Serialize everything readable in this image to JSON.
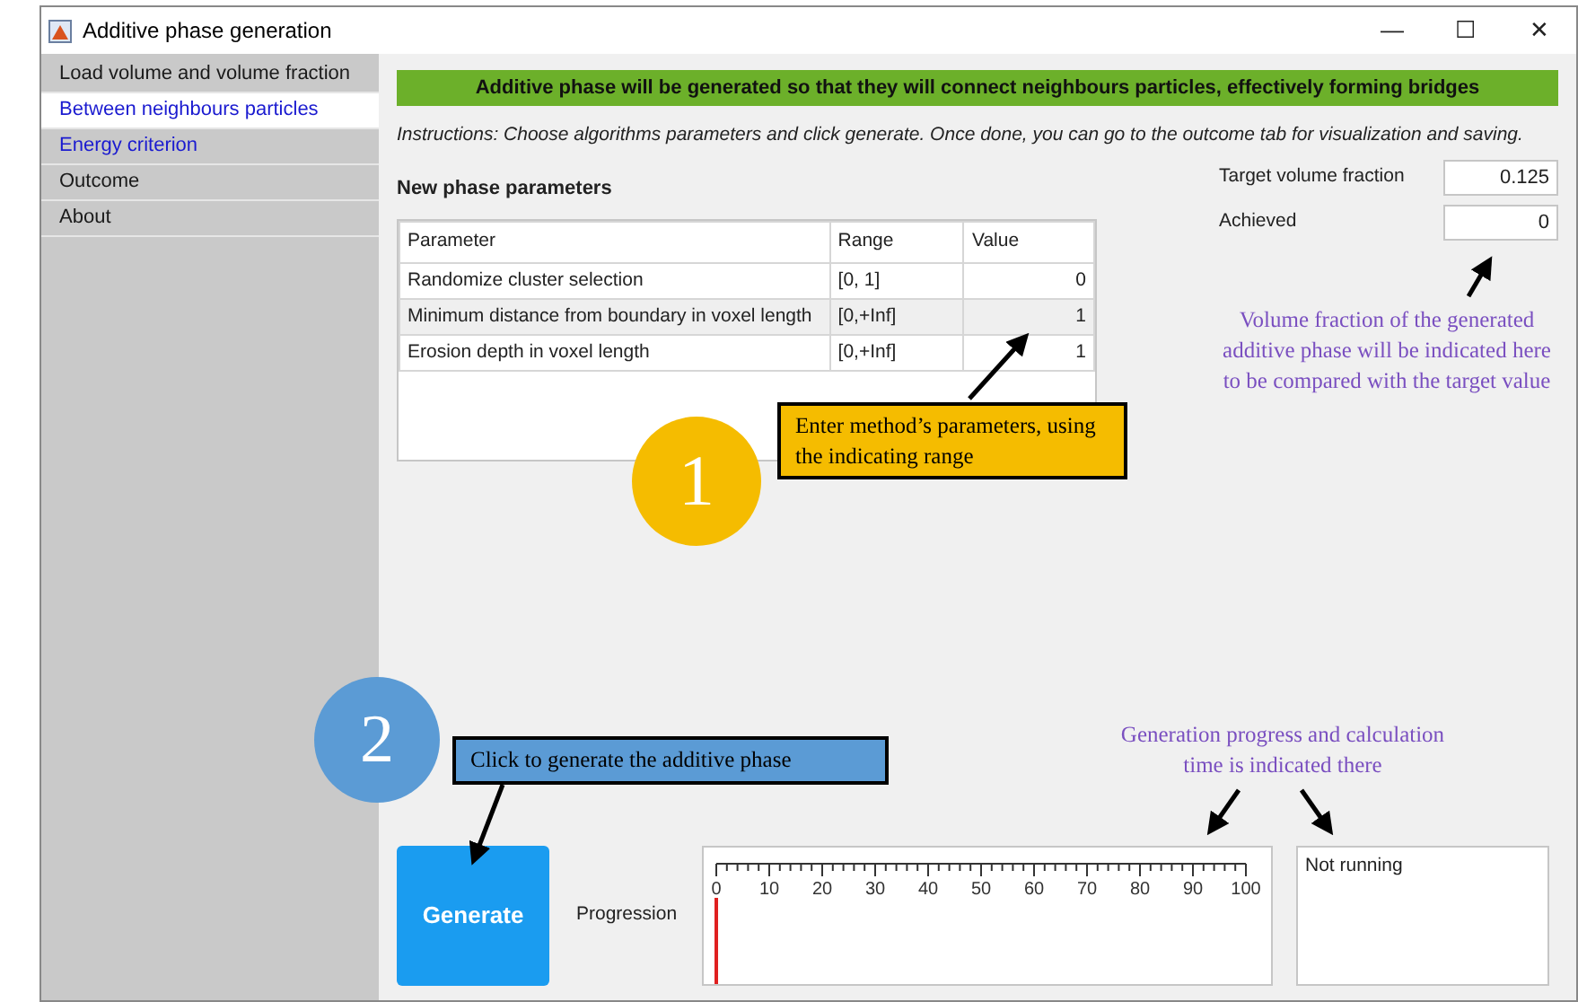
{
  "window": {
    "title": "Additive phase generation",
    "controls": [
      "—",
      "☐",
      "✕"
    ]
  },
  "sidebar": {
    "items": [
      {
        "label": "Load volume and volume fraction",
        "selected": false,
        "color": "#1a1a1a"
      },
      {
        "label": "Between neighbours particles",
        "selected": true,
        "color": "#1a1ad0"
      },
      {
        "label": "Energy criterion",
        "selected": false,
        "color": "#1a1ad0"
      },
      {
        "label": "Outcome",
        "selected": false,
        "color": "#1a1a1a"
      },
      {
        "label": "About",
        "selected": false,
        "color": "#1a1a1a"
      }
    ]
  },
  "banner": "Additive phase will be generated so that they will connect neighbours particles, effectively forming bridges",
  "instructions": "Instructions: Choose algorithms parameters and click generate. Once done, you can go to the outcome tab for visualization and saving.",
  "section_title": "New phase parameters",
  "table": {
    "columns": [
      "Parameter",
      "Range",
      "Value"
    ],
    "rows": [
      [
        "Randomize cluster selection",
        "[0, 1]",
        "0"
      ],
      [
        "Minimum distance from boundary in voxel length",
        "[0,+Inf]",
        "1"
      ],
      [
        "Erosion depth in voxel length",
        "[0,+Inf]",
        "1"
      ]
    ]
  },
  "fields": [
    {
      "label": "Target volume fraction",
      "value": "0.125"
    },
    {
      "label": "Achieved",
      "value": "0"
    }
  ],
  "generate_button": "Generate",
  "progress": {
    "label": "Progression",
    "level": 0,
    "scale_labels": [
      "0",
      "10",
      "20",
      "30",
      "40",
      "50",
      "60",
      "70",
      "80",
      "90",
      "100"
    ]
  },
  "status": "Not running",
  "annotations": [
    {
      "kind": "note",
      "text": "Volume fraction of the generated additive phase will be indicated here to be compared with the target value"
    },
    {
      "kind": "callout",
      "text": "Enter method’s parameters, using the indicating range",
      "color": "#f5bc00"
    },
    {
      "kind": "step",
      "text": "1",
      "color": "#f5bc00"
    },
    {
      "kind": "step",
      "text": "2",
      "color": "#5b9bd5"
    },
    {
      "kind": "callout",
      "text": "Click to generate the additive phase",
      "color": "#5b9bd5"
    },
    {
      "kind": "note",
      "text": "Generation progress and calculation time is indicated there"
    }
  ]
}
